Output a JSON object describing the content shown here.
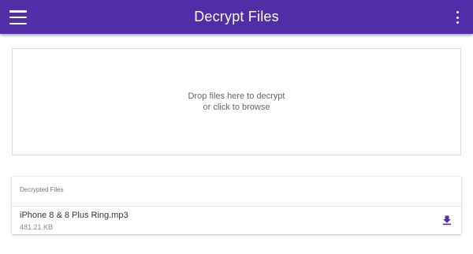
{
  "appbar": {
    "title": "Decrypt Files",
    "menu_icon": "hamburger-menu-icon",
    "more_icon": "more-vert-icon",
    "color": "#512da8"
  },
  "dropzone": {
    "line1": "Drop files here to decrypt",
    "line2": "or click to browse"
  },
  "decrypted": {
    "header": "Decrypted Files",
    "files": [
      {
        "name": "iPhone 8 & 8 Plus Ring.mp3",
        "size": "481.21 KB",
        "action_icon": "download-icon"
      }
    ]
  }
}
